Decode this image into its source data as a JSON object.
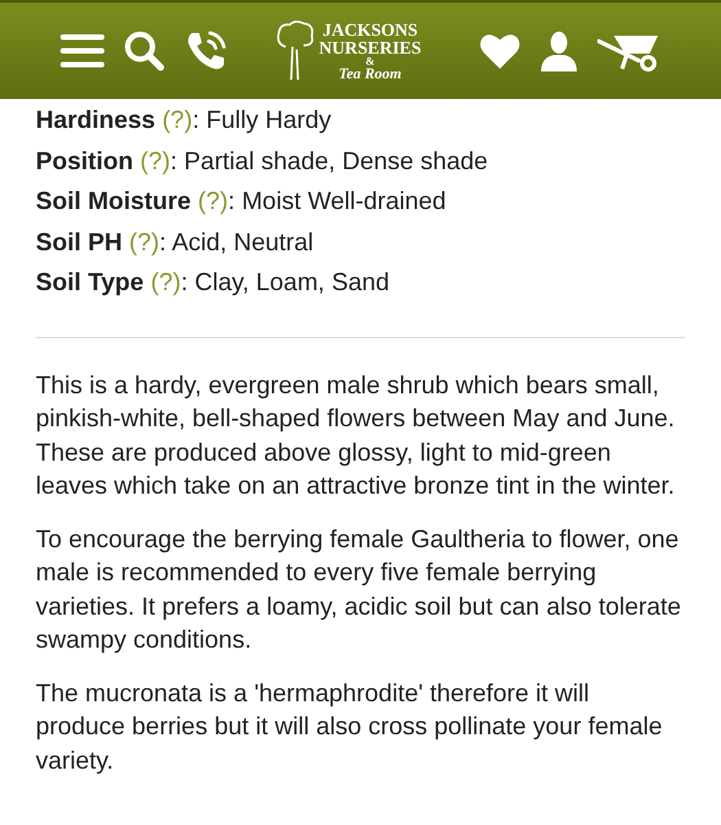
{
  "header": {
    "logo": {
      "lines": [
        "JACKSONS",
        "NURSERIES",
        "&",
        "Tea Room"
      ]
    }
  },
  "attributes": [
    {
      "label": "Hardiness",
      "help": "(?)",
      "separator": ":",
      "value": "Fully Hardy"
    },
    {
      "label": "Position",
      "help": "(?)",
      "separator": ":",
      "value": "Partial shade, Dense shade"
    },
    {
      "label": "Soil Moisture",
      "help": "(?)",
      "separator": ":",
      "value": "Moist Well-drained"
    },
    {
      "label": "Soil PH",
      "help": "(?)",
      "separator": ":",
      "value": "Acid, Neutral"
    },
    {
      "label": "Soil Type",
      "help": "(?)",
      "separator": ":",
      "value": "Clay, Loam, Sand"
    }
  ],
  "description": [
    "This is a hardy, evergreen male shrub which bears small, pinkish-white, bell-shaped flowers between May and June. These are produced above glossy, light to mid-green leaves which take on an attractive bronze tint in the winter.",
    "To encourage the berrying female Gaultheria to flower, one male is recommended to every five female berrying varieties. It prefers a loamy, acidic soil but can also tolerate swampy conditions.",
    "The mucronata is a 'hermaphrodite' therefore it will produce berries but it will also cross pollinate your female variety."
  ]
}
